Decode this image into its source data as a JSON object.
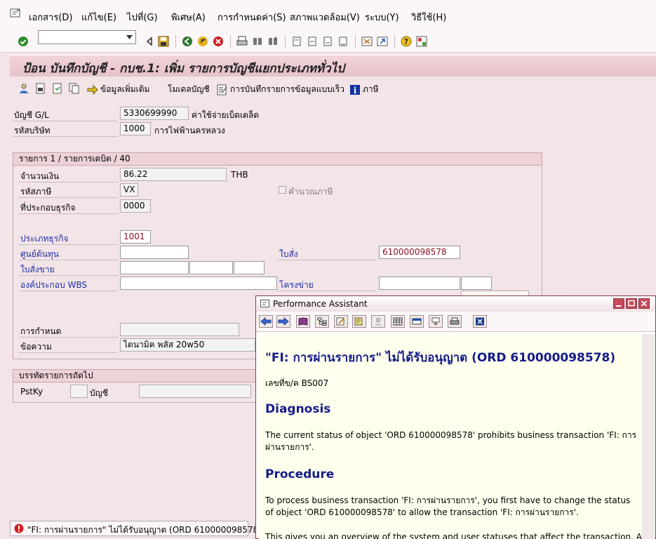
{
  "menu": [
    "เอกสาร(D)",
    "แก้ไข(E)",
    "ไปที่(G)",
    "พิเศษ(A)",
    "การกำหนดค่า(S)",
    "สภาพแวดล้อม(V)",
    "ระบบ(Y)",
    "วิธีใช้(H)"
  ],
  "title": "ป้อน บันทึกบัญชี - กบช.1: เพิ่ม รายการบัญชีแยกประเภททั่วไป",
  "app_toolbar": {
    "additional_data": "ข้อมูลเพิ่มเติม",
    "account_model": "โมเดลบัญชี",
    "fast_entry": "การบันทึกรายการข้อมูลแบบเร็ว",
    "taxes": "ภาษี"
  },
  "header": {
    "gl_account_label": "บัญชี G/L",
    "gl_account_value": "5330699990",
    "gl_account_text": "ค่าใช้จ่ายเบ็ดเตล็ด",
    "company_code_label": "รหัสบริษัท",
    "company_code_value": "1000",
    "company_code_text": "การไฟฟ้านครหลวง"
  },
  "item": {
    "group_title": "รายการ 1 / รายการเดบิต / 40",
    "amount_label": "จำนวนเงิน",
    "amount_value": "86.22",
    "currency": "THB",
    "tax_code_label": "รหัสภาษี",
    "tax_code_value": "VX",
    "calc_tax_label": "คำนวณภาษี",
    "business_area_label": "ที่ประกอบธุรกิจ",
    "business_area_value": "0000",
    "business_type_label": "ประเภทธุรกิจ",
    "business_type_value": "1001",
    "cost_center_label": "ศูนย์ต้นทุน",
    "order_label": "ใบสั่ง",
    "order_value": "610000098578",
    "sales_order_label": "ใบสั่งขาย",
    "wbs_label": "องค์ประกอบ WBS",
    "network_label": "โครงข่าย",
    "assignment_label": "การกำหนด",
    "text_label": "ข้อความ",
    "text_value": "ไดนามิค พลัส 20w50"
  },
  "next_item": {
    "group_title": "บรรทัดรายการถัดไป",
    "pstky_label": "PstKy",
    "account_label": "บัญชี"
  },
  "status": {
    "message": "\"FI: การผ่านรายการ\" ไม่ได้รับอนุญาต (ORD 610000098578)"
  },
  "performance_assistant": {
    "window_title": "Performance Assistant",
    "heading": "\"FI: การผ่านรายการ\" ไม่ได้รับอนุญาต (ORD 610000098578)",
    "message_no": "เลขที่ข/ค BS007",
    "diagnosis_title": "Diagnosis",
    "diagnosis_text": "The current status of object 'ORD 610000098578' prohibits business transaction 'FI: การผ่านรายการ'.",
    "procedure_title": "Procedure",
    "procedure_text": "To process business transaction 'FI: การผ่านรายการ', you first have to change the status of object 'ORD 610000098578' to allow the transaction 'FI: การผ่านรายการ'.",
    "overview_text": "This gives you an overview of the system and user statuses that affect the transaction. A"
  }
}
